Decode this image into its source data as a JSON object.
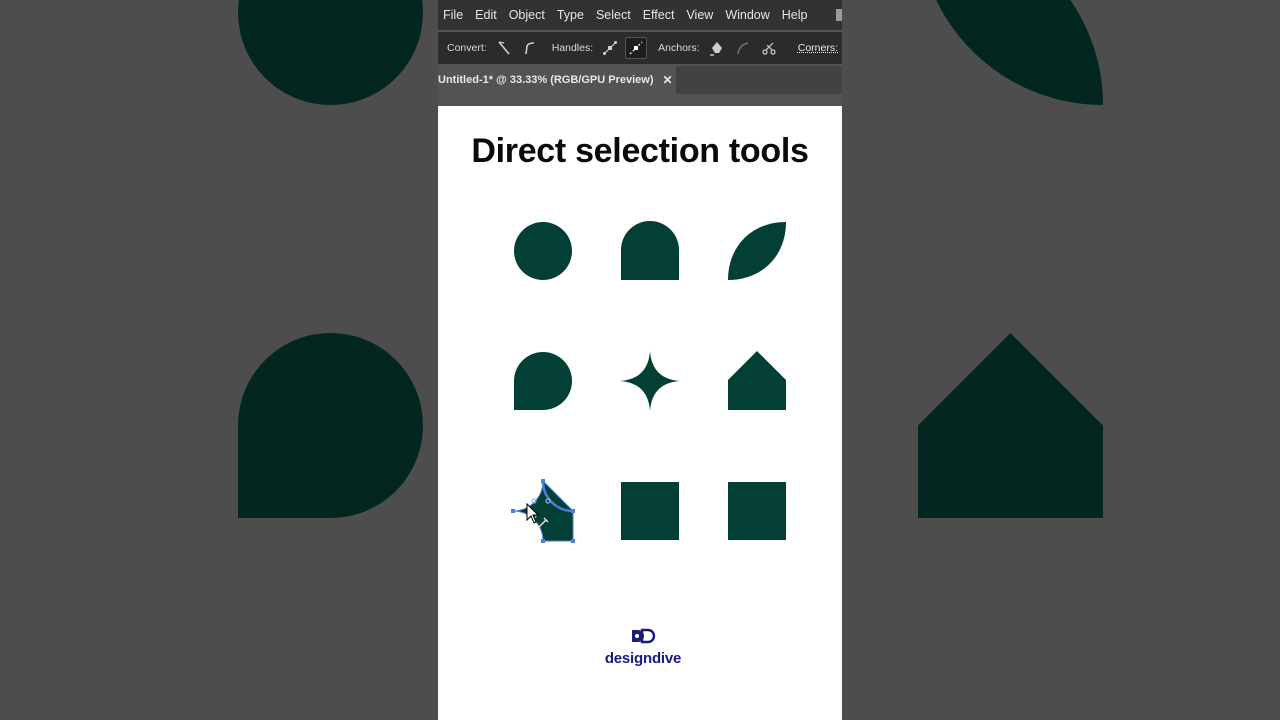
{
  "colors": {
    "shape_fill": "#043f36",
    "selection": "#4a7fd8",
    "brand": "#1b1b7a"
  },
  "menubar": {
    "items": [
      {
        "label": "File"
      },
      {
        "label": "Edit"
      },
      {
        "label": "Object"
      },
      {
        "label": "Type"
      },
      {
        "label": "Select"
      },
      {
        "label": "Effect"
      },
      {
        "label": "View"
      },
      {
        "label": "Window"
      },
      {
        "label": "Help"
      }
    ]
  },
  "controlbar": {
    "convert_label": "Convert:",
    "handles_label": "Handles:",
    "anchors_label": "Anchors:",
    "corners_label": "Corners:"
  },
  "tab": {
    "title": "Untitled-1* @ 33.33% (RGB/GPU Preview)",
    "close": "✕"
  },
  "artboard": {
    "title": "Direct selection tools"
  },
  "logo": {
    "wordmark": "designdive"
  }
}
